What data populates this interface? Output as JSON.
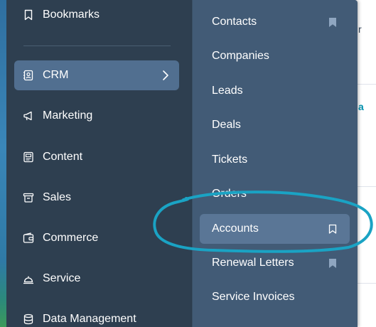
{
  "sidebar": {
    "items": [
      {
        "label": "Bookmarks",
        "icon": "bookmark-icon"
      },
      {
        "label": "CRM",
        "icon": "contact-card-icon",
        "active": true
      },
      {
        "label": "Marketing",
        "icon": "megaphone-icon"
      },
      {
        "label": "Content",
        "icon": "content-icon"
      },
      {
        "label": "Sales",
        "icon": "sales-icon"
      },
      {
        "label": "Commerce",
        "icon": "wallet-icon"
      },
      {
        "label": "Service",
        "icon": "service-bell-icon"
      },
      {
        "label": "Data Management",
        "icon": "database-icon"
      }
    ]
  },
  "crm_menu": {
    "items": [
      {
        "label": "Contacts",
        "bookmark": "filled"
      },
      {
        "label": "Companies",
        "bookmark": "none"
      },
      {
        "label": "Leads",
        "bookmark": "none"
      },
      {
        "label": "Deals",
        "bookmark": "none"
      },
      {
        "label": "Tickets",
        "bookmark": "none"
      },
      {
        "label": "Orders",
        "bookmark": "none"
      },
      {
        "label": "Accounts",
        "bookmark": "outline",
        "active": true
      },
      {
        "label": "Renewal Letters",
        "bookmark": "filled"
      },
      {
        "label": "Service Invoices",
        "bookmark": "none"
      }
    ]
  },
  "page_behind": {
    "fragment_1": "r",
    "fragment_2": "a"
  },
  "colors": {
    "sidebar_bg": "#2e3f50",
    "flyout_bg": "#425b76",
    "active_bg": "#516f90",
    "annotation": "#1aa3c4"
  }
}
